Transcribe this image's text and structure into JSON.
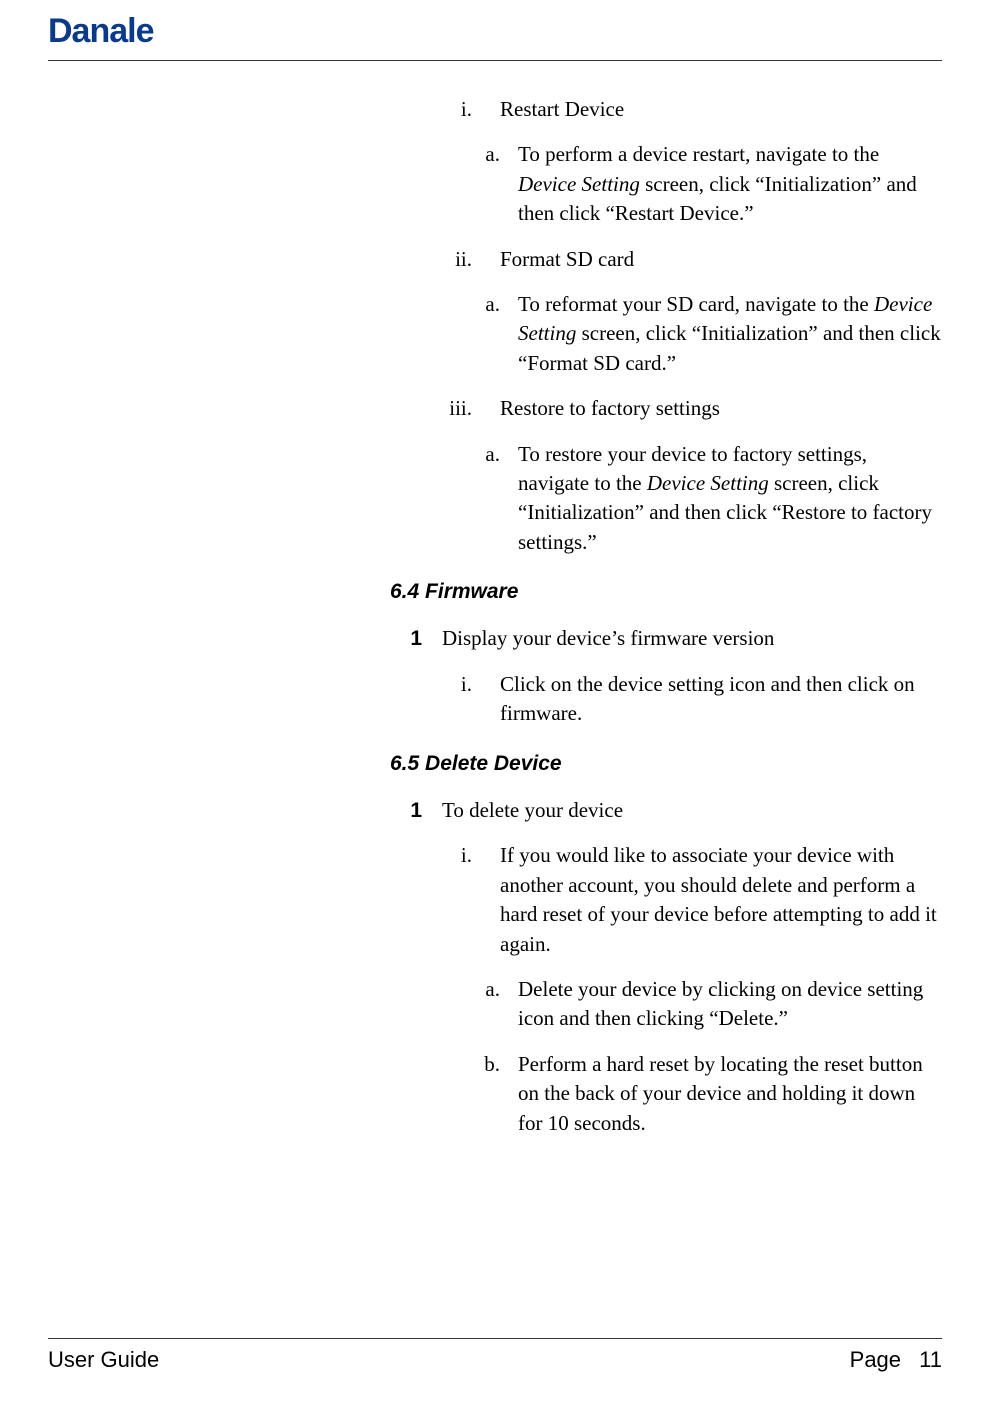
{
  "brand": "Danale",
  "items": {
    "roman1_marker": "i.",
    "roman1_text": "Restart Device",
    "alpha1a_marker": "a.",
    "alpha1a_pre": "To perform a device restart, navigate to the ",
    "alpha1a_italic": "Device Setting",
    "alpha1a_post": " screen, click “Initialization” and then click “Restart Device.”",
    "roman2_marker": "ii.",
    "roman2_text": "Format SD card",
    "alpha2a_marker": "a.",
    "alpha2a_pre": "To reformat your SD card, navigate to the ",
    "alpha2a_italic": "Device Setting",
    "alpha2a_post": " screen, click “Initialization” and then click “Format SD card.”",
    "roman3_marker": "iii.",
    "roman3_text": "Restore to factory settings",
    "alpha3a_marker": "a.",
    "alpha3a_pre": "To restore your device to factory settings, navigate to the ",
    "alpha3a_italic": "Device Setting",
    "alpha3a_post": " screen, click “Initialization” and then click “Restore to factory settings.”"
  },
  "section64": {
    "heading": "6.4 Firmware",
    "num1_marker": "1",
    "num1_text": "Display your device’s firmware version",
    "roman1_marker": "i.",
    "roman1_text": "Click on the device setting icon and then click on firmware."
  },
  "section65": {
    "heading": "6.5 Delete Device",
    "num1_marker": "1",
    "num1_text": "To delete your device",
    "roman1_marker": "i.",
    "roman1_text": "If you would like to associate your device with another account, you should delete and perform a hard reset of your device before attempting to add it again.",
    "alpha_a_marker": "a.",
    "alpha_a_text": "Delete your device by clicking on device setting icon and then clicking “Delete.”",
    "alpha_b_marker": "b.",
    "alpha_b_text": "Perform a hard reset by locating the reset button on the back of your device and holding it down for 10 seconds."
  },
  "footer": {
    "left": "User Guide",
    "page_label": "Page",
    "page_num": "11"
  }
}
